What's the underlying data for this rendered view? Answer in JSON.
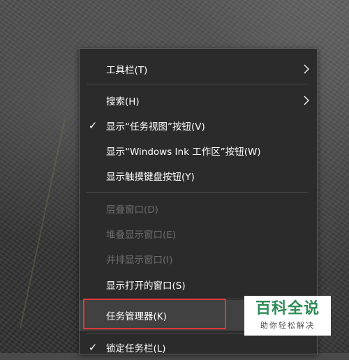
{
  "menu": {
    "items": [
      {
        "label": "工具栏(T)",
        "checked": false,
        "disabled": false,
        "submenu": true
      },
      {
        "label": "搜索(H)",
        "checked": false,
        "disabled": false,
        "submenu": true
      },
      {
        "label": "显示“任务视图”按钮(V)",
        "checked": true,
        "disabled": false,
        "submenu": false
      },
      {
        "label": "显示“Windows Ink 工作区”按钮(W)",
        "checked": false,
        "disabled": false,
        "submenu": false
      },
      {
        "label": "显示触摸键盘按钮(Y)",
        "checked": false,
        "disabled": false,
        "submenu": false
      },
      {
        "label": "层叠窗口(D)",
        "checked": false,
        "disabled": true,
        "submenu": false
      },
      {
        "label": "堆叠显示窗口(E)",
        "checked": false,
        "disabled": true,
        "submenu": false
      },
      {
        "label": "并排显示窗口(I)",
        "checked": false,
        "disabled": true,
        "submenu": false
      },
      {
        "label": "显示打开的窗口(S)",
        "checked": false,
        "disabled": false,
        "submenu": false
      },
      {
        "label": "任务管理器(K)",
        "checked": false,
        "disabled": false,
        "submenu": false,
        "highlighted": true
      },
      {
        "label": "锁定任务栏(L)",
        "checked": true,
        "disabled": false,
        "submenu": false
      }
    ],
    "check_glyph": "✓",
    "submenu_icon": "chevron-right-icon"
  },
  "highlight_color": "#e03a3a",
  "watermark": {
    "title": "百科全说",
    "subtitle": "助你轻松解决",
    "title_color": "#2e8b57"
  }
}
